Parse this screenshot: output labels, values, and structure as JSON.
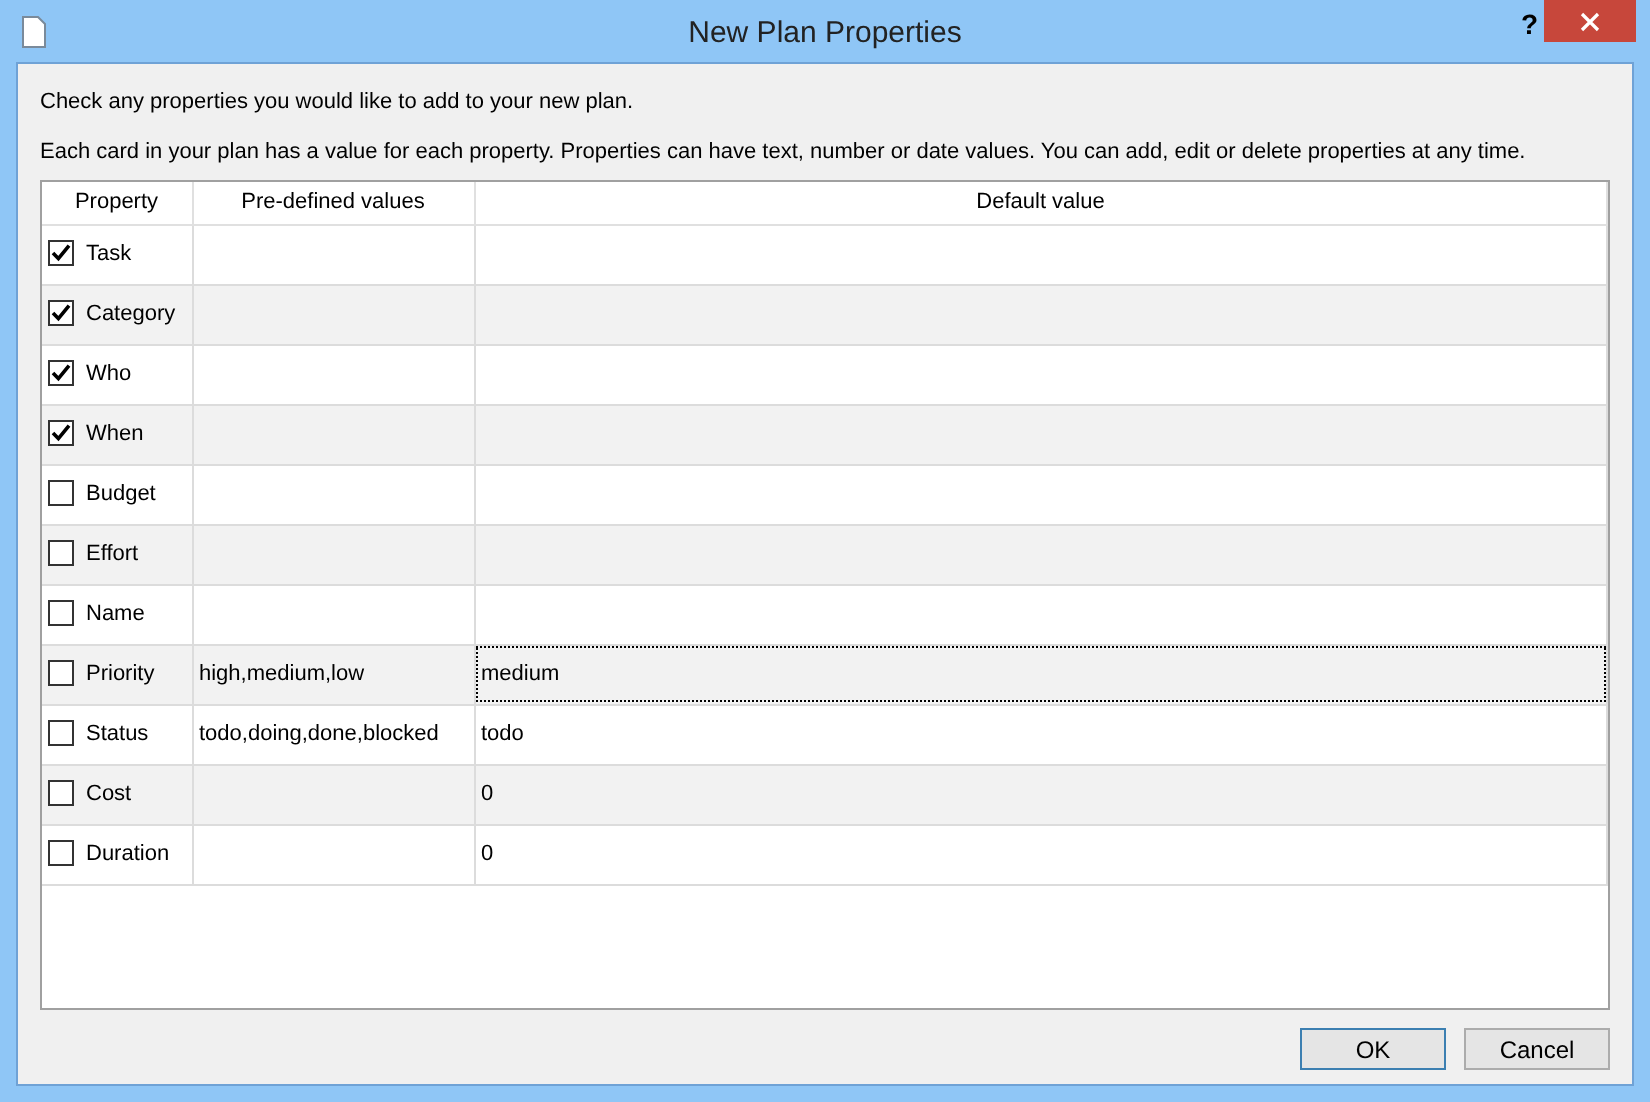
{
  "window": {
    "title": "New Plan Properties",
    "help_button": "?"
  },
  "instructions": [
    "Check any properties you would like to add to your new plan.",
    "Each card in your plan has a value for each property. Properties can have text, number or date values. You can add, edit or delete properties at any time."
  ],
  "table": {
    "columns": [
      "Property",
      "Pre-defined values",
      "Default value"
    ],
    "rows": [
      {
        "property": "Task",
        "checked": true,
        "focused": false
      },
      {
        "property": "Category",
        "checked": true,
        "focused": false
      },
      {
        "property": "Who",
        "checked": true,
        "focused": false
      },
      {
        "property": "When",
        "checked": true,
        "focused": false
      },
      {
        "property": "Budget",
        "checked": false,
        "focused": false
      },
      {
        "property": "Effort",
        "checked": false,
        "focused": false
      },
      {
        "property": "Name",
        "checked": false,
        "focused": false
      },
      {
        "property": "Priority",
        "checked": false,
        "predefined_values": "high,medium,low",
        "default_value": "medium",
        "focused": true
      },
      {
        "property": "Status",
        "checked": false,
        "predefined_values": "todo,doing,done,blocked",
        "default_value": "todo",
        "focused": false
      },
      {
        "property": "Cost",
        "checked": false,
        "default_value": "0",
        "focused": false
      },
      {
        "property": "Duration",
        "checked": false,
        "default_value": "0",
        "focused": false
      }
    ]
  },
  "buttons": [
    {
      "label": "OK",
      "default": true
    },
    {
      "label": "Cancel",
      "default": false
    }
  ]
}
